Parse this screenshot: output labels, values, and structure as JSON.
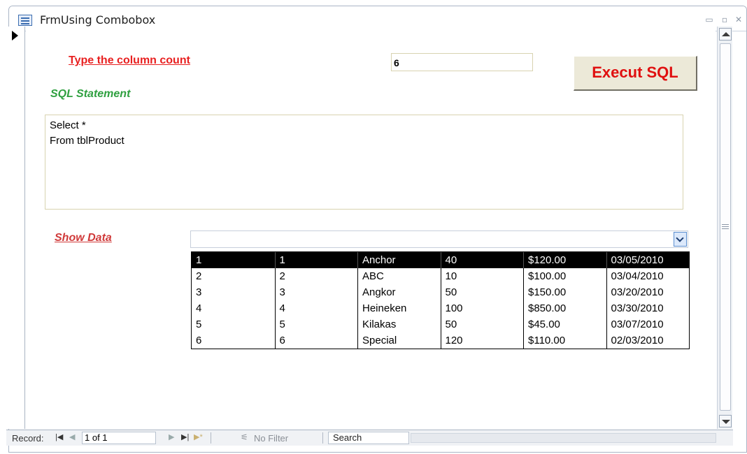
{
  "window": {
    "title": "FrmUsing Combobox"
  },
  "form": {
    "column_count_label": "Type the column count",
    "column_count_value": "6",
    "execute_label": "Execut SQL",
    "sql_label": "SQL Statement",
    "sql_text": "Select *\nFrom tblProduct",
    "show_data_label": "Show Data"
  },
  "combo": {
    "value": "",
    "rows": [
      [
        "1",
        "1",
        "Anchor",
        "40",
        "$120.00",
        "03/05/2010"
      ],
      [
        "2",
        "2",
        "ABC",
        "10",
        "$100.00",
        "03/04/2010"
      ],
      [
        "3",
        "3",
        "Angkor",
        "50",
        "$150.00",
        "03/20/2010"
      ],
      [
        "4",
        "4",
        "Heineken",
        "100",
        "$850.00",
        "03/30/2010"
      ],
      [
        "5",
        "5",
        "Kilakas",
        "50",
        "$45.00",
        "03/07/2010"
      ],
      [
        "6",
        "6",
        "Special",
        "120",
        "$110.00",
        "02/03/2010"
      ]
    ],
    "selected_row": 0
  },
  "navigation": {
    "record_label": "Record:",
    "position": "1 of 1",
    "filter_label": "No Filter",
    "search_label": "Search"
  },
  "colors": {
    "label_red": "#e82020",
    "label_green": "#2fa040",
    "selected_row_bg": "#000000"
  }
}
